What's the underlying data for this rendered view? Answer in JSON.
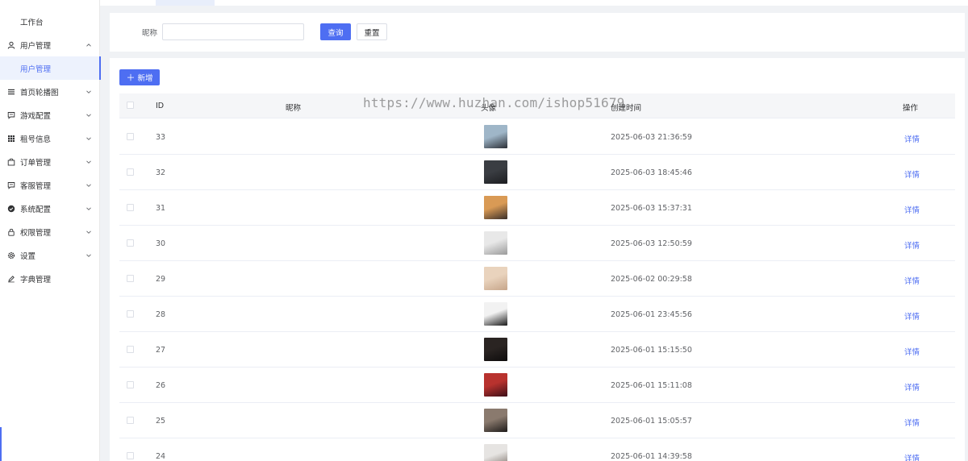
{
  "sidebar": {
    "workbench": "工作台",
    "items": [
      {
        "label": "用户管理",
        "icon": "user-icon",
        "expanded": true
      },
      {
        "label": "用户管理",
        "sub": true,
        "active": true
      },
      {
        "label": "首页轮播图",
        "icon": "list-icon"
      },
      {
        "label": "游戏配置",
        "icon": "chat-icon"
      },
      {
        "label": "租号信息",
        "icon": "grid-icon"
      },
      {
        "label": "订单管理",
        "icon": "bag-icon"
      },
      {
        "label": "客服管理",
        "icon": "chat-icon"
      },
      {
        "label": "系统配置",
        "icon": "check-circle-icon"
      },
      {
        "label": "权限管理",
        "icon": "lock-icon"
      },
      {
        "label": "设置",
        "icon": "gear-icon"
      },
      {
        "label": "字典管理",
        "icon": "edit-icon"
      }
    ]
  },
  "search": {
    "label": "昵称",
    "value": "",
    "placeholder": "",
    "query_label": "查询",
    "reset_label": "重置"
  },
  "toolbar": {
    "add_label": "新增"
  },
  "table": {
    "columns": {
      "id": "ID",
      "nickname": "昵称",
      "avatar": "头像",
      "created": "创建时间",
      "action": "操作"
    },
    "rows": [
      {
        "id": "33",
        "created": "2025-06-03 21:36:59",
        "action": "详情",
        "avatar_colors": [
          "#9fb6c8",
          "#2b2f36"
        ]
      },
      {
        "id": "32",
        "created": "2025-06-03 18:45:46",
        "action": "详情",
        "avatar_colors": [
          "#3a3d42",
          "#1c1d20"
        ]
      },
      {
        "id": "31",
        "created": "2025-06-03 15:37:31",
        "action": "详情",
        "avatar_colors": [
          "#d99a55",
          "#3a2f2a"
        ]
      },
      {
        "id": "30",
        "created": "2025-06-03 12:50:59",
        "action": "详情",
        "avatar_colors": [
          "#e8e8e8",
          "#9a9a9a"
        ]
      },
      {
        "id": "29",
        "created": "2025-06-02 00:29:58",
        "action": "详情",
        "avatar_colors": [
          "#e9d3bd",
          "#c6a58a"
        ]
      },
      {
        "id": "28",
        "created": "2025-06-01 23:45:56",
        "action": "详情",
        "avatar_colors": [
          "#f2f2f2",
          "#1a1a1a"
        ]
      },
      {
        "id": "27",
        "created": "2025-06-01 15:15:50",
        "action": "详情",
        "avatar_colors": [
          "#2a2422",
          "#0e0c0c"
        ]
      },
      {
        "id": "26",
        "created": "2025-06-01 15:11:08",
        "action": "详情",
        "avatar_colors": [
          "#b8322e",
          "#3c0f18"
        ]
      },
      {
        "id": "25",
        "created": "2025-06-01 15:05:57",
        "action": "详情",
        "avatar_colors": [
          "#8a7a6e",
          "#1e1b1a"
        ]
      },
      {
        "id": "24",
        "created": "2025-06-01 14:39:58",
        "action": "详情",
        "avatar_colors": [
          "#e6e4e2",
          "#7a6f68"
        ]
      }
    ]
  },
  "watermark": "https://www.huzhan.com/ishop51679",
  "colors": {
    "primary": "#4e6ef2",
    "active_bg": "#edf2fd",
    "header_bg": "#f5f6f8"
  }
}
